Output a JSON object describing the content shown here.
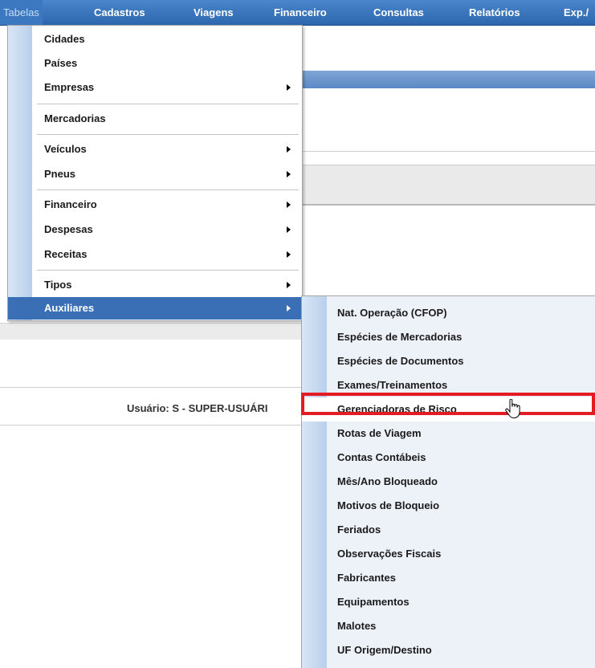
{
  "menubar": {
    "items": [
      "Tabelas",
      "Cadastros",
      "Viagens",
      "Financeiro",
      "Consultas",
      "Relatórios",
      "Exp./"
    ]
  },
  "page": {
    "usuario": "Usuário: S - SUPER-USUÁRI"
  },
  "dropdown": {
    "items": [
      "Cidades",
      "Países",
      "Empresas",
      "Mercadorias",
      "Veículos",
      "Pneus",
      "Financeiro",
      "Despesas",
      "Receitas",
      "Tipos",
      "Auxiliares"
    ]
  },
  "submenu": {
    "items": [
      "Nat. Operação (CFOP)",
      "Espécies de Mercadorias",
      "Espécies de Documentos",
      "Exames/Treinamentos",
      "Gerenciadoras de Risco",
      "Rotas de Viagem",
      "Contas Contábeis",
      "Mês/Ano Bloqueado",
      "Motivos de Bloqueio",
      "Feriados",
      "Observações Fiscais",
      "Fabricantes",
      "Equipamentos",
      "Malotes",
      "UF Origem/Destino"
    ]
  },
  "colors": {
    "menubar": "#2d66ad",
    "highlight": "#3a6fb5",
    "callout": "#e31b23"
  }
}
